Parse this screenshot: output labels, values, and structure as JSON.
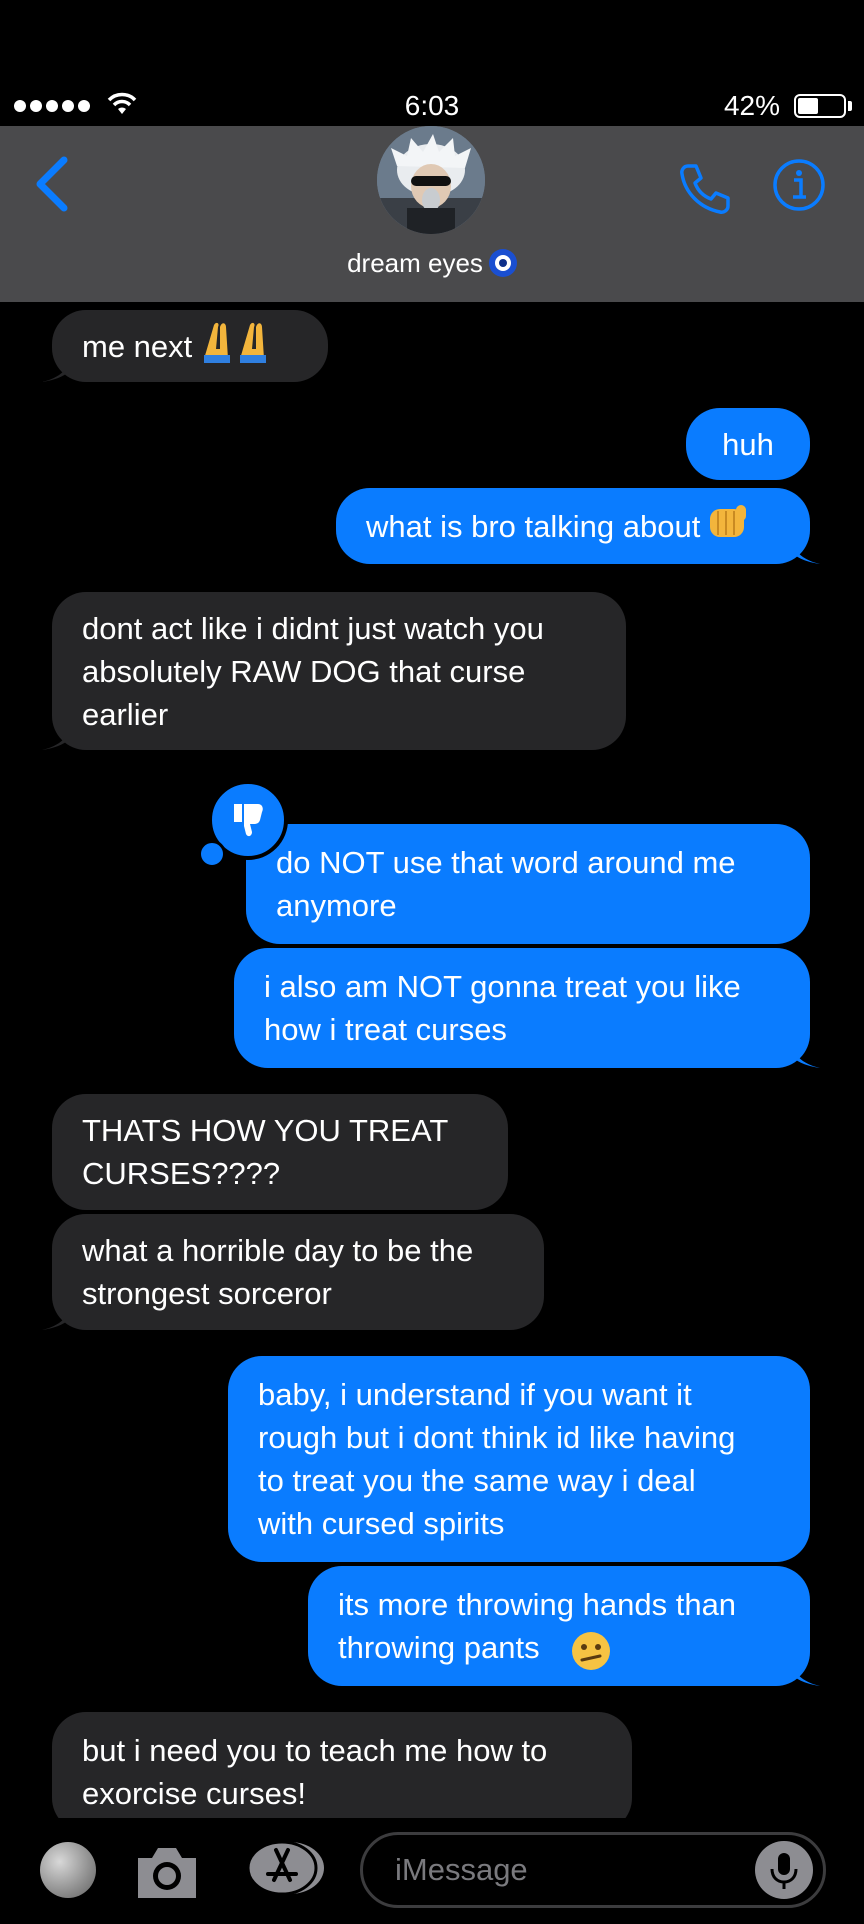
{
  "status_bar": {
    "time": "6:03",
    "battery": "42%"
  },
  "header": {
    "contact_name": "dream eyes"
  },
  "messages": [
    {
      "dir": "in",
      "text": "me next"
    },
    {
      "dir": "out",
      "text": "huh"
    },
    {
      "dir": "out",
      "text": "what is bro talking about"
    },
    {
      "dir": "in",
      "text": "dont act like i didnt just watch you\nabsolutely RAW DOG that curse\nearlier"
    },
    {
      "dir": "out",
      "text": "do NOT use that word around me\nanymore",
      "tapback": "thumbs-down"
    },
    {
      "dir": "out",
      "text": "i also am NOT gonna treat you like\nhow i treat curses"
    },
    {
      "dir": "in",
      "text": "THATS HOW YOU TREAT\nCURSES????"
    },
    {
      "dir": "in",
      "text": "what a horrible day to be the\nstrongest sorceror"
    },
    {
      "dir": "out",
      "text": "baby, i understand if you want it\nrough but i dont think id like having\nto treat you the same way i deal\nwith cursed spirits"
    },
    {
      "dir": "out",
      "text": "its more throwing hands than\nthrowing pants"
    },
    {
      "dir": "in",
      "text": "but i need you to teach me how to\nexorcise curses!"
    }
  ],
  "input": {
    "placeholder": "iMessage"
  },
  "colors": {
    "outgoing": "#0a7cff",
    "incoming": "#262628",
    "header_bg": "#4a4a4c",
    "accent": "#0a7cff"
  },
  "icons": [
    "back-chevron-icon",
    "phone-icon",
    "info-icon",
    "moon-icon",
    "camera-icon",
    "app-store-icon",
    "mic-icon",
    "thumbs-down-icon"
  ]
}
